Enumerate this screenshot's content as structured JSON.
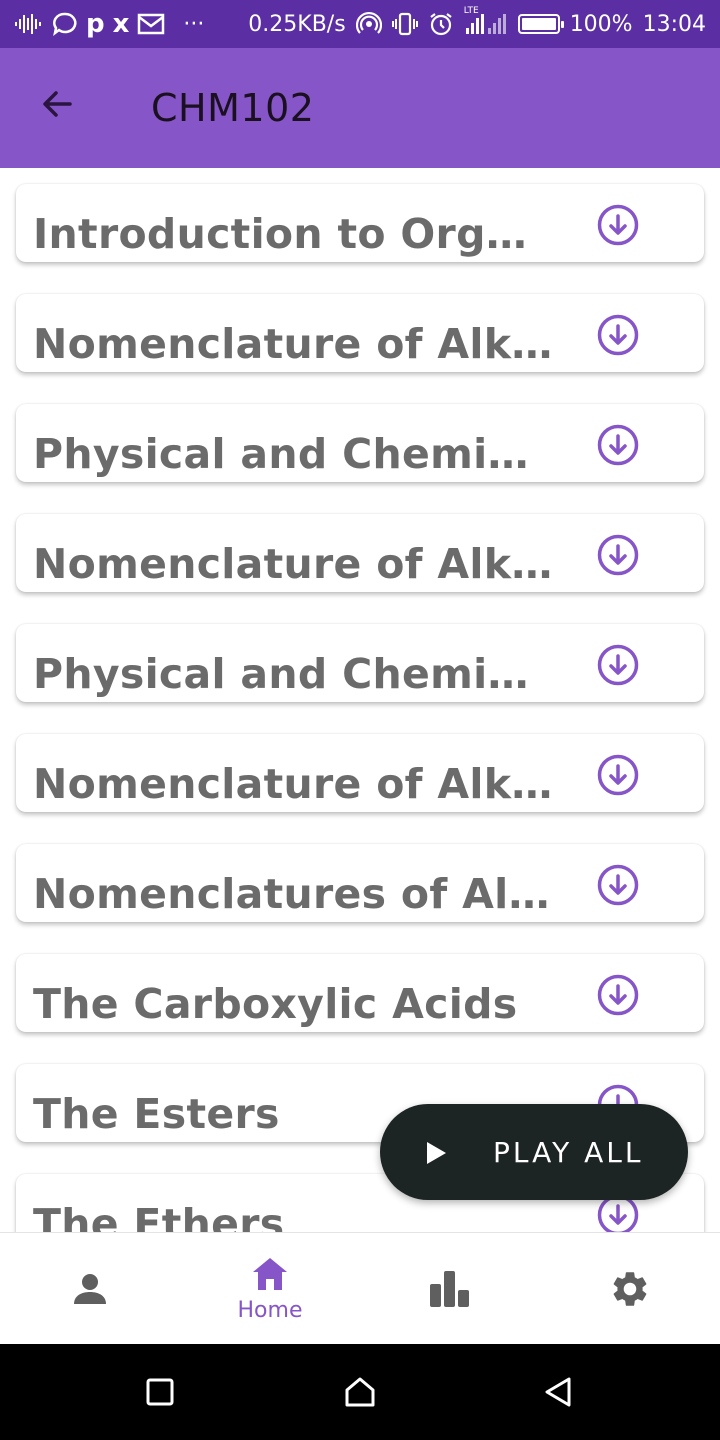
{
  "status_bar": {
    "letter_p": "p",
    "letter_x": "x",
    "more": "···",
    "network_speed": "0.25KB/s",
    "lte_label": "LTE",
    "battery_percent": "100%",
    "battery_level": 1.0,
    "time": "13:04"
  },
  "app_bar": {
    "title": "CHM102",
    "background": "#8655c8"
  },
  "lessons": [
    {
      "title": "Introduction to Orga..."
    },
    {
      "title": "Nomenclature of Alk..."
    },
    {
      "title": "Physical and Chemic..."
    },
    {
      "title": "Nomenclature of Alk..."
    },
    {
      "title": "Physical and Chemic..."
    },
    {
      "title": "Nomenclature of Alk..."
    },
    {
      "title": "Nomenclatures of Al..."
    },
    {
      "title": "The Carboxylic Acids"
    },
    {
      "title": "The Esters"
    },
    {
      "title": "The Ethers"
    }
  ],
  "fab": {
    "label": "PLAY ALL"
  },
  "bottom_nav": {
    "home_label": "Home",
    "accent": "#8655c8",
    "inactive": "#5f5f5f"
  }
}
